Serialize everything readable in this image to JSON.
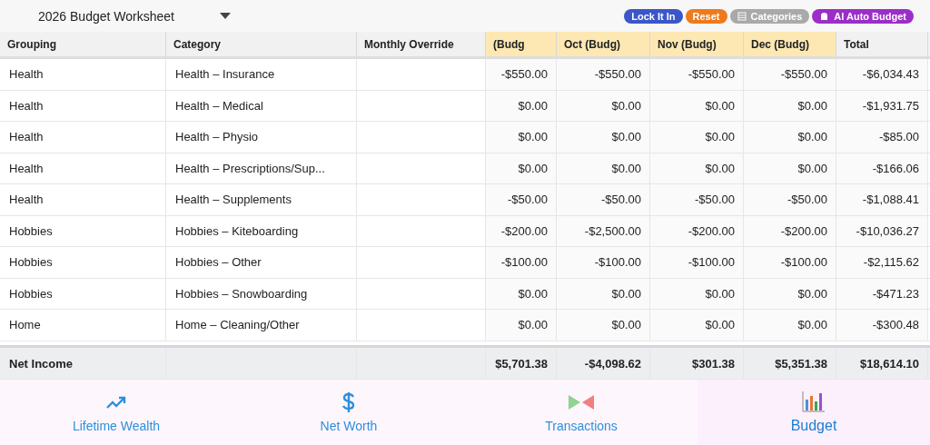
{
  "toolbar": {
    "title": "2026 Budget Worksheet",
    "buttons": [
      {
        "label": "Lock It In",
        "kind": "lock",
        "color": "#3a56c8"
      },
      {
        "label": "Reset",
        "kind": "reset",
        "color": "#ee7a1c"
      },
      {
        "label": "Categories",
        "kind": "categories",
        "color": "#a9a9a9"
      },
      {
        "label": "AI Auto Budget",
        "kind": "ai",
        "color": "#9b2ec8"
      }
    ]
  },
  "table": {
    "columns": [
      {
        "label": "Grouping",
        "kind": "frozen"
      },
      {
        "label": "Category",
        "kind": "frozen"
      },
      {
        "label": "Monthly Override",
        "kind": "frozen"
      },
      {
        "label": "(Budg",
        "kind": "month"
      },
      {
        "label": "Oct (Budg)",
        "kind": "month"
      },
      {
        "label": "Nov (Budg)",
        "kind": "month"
      },
      {
        "label": "Dec (Budg)",
        "kind": "month"
      },
      {
        "label": "Total",
        "kind": "total"
      }
    ],
    "rows": [
      {
        "grouping": "Health",
        "category": "Health – Insurance",
        "values": [
          "-$550.00",
          "-$550.00",
          "-$550.00",
          "-$550.00",
          "-$6,034.43"
        ]
      },
      {
        "grouping": "Health",
        "category": "Health – Medical",
        "values": [
          "$0.00",
          "$0.00",
          "$0.00",
          "$0.00",
          "-$1,931.75"
        ]
      },
      {
        "grouping": "Health",
        "category": "Health – Physio",
        "values": [
          "$0.00",
          "$0.00",
          "$0.00",
          "$0.00",
          "-$85.00"
        ]
      },
      {
        "grouping": "Health",
        "category": "Health – Prescriptions/Sup...",
        "values": [
          "$0.00",
          "$0.00",
          "$0.00",
          "$0.00",
          "-$166.06"
        ]
      },
      {
        "grouping": "Health",
        "category": "Health – Supplements",
        "values": [
          "-$50.00",
          "-$50.00",
          "-$50.00",
          "-$50.00",
          "-$1,088.41"
        ]
      },
      {
        "grouping": "Hobbies",
        "category": "Hobbies – Kiteboarding",
        "values": [
          "-$200.00",
          "-$2,500.00",
          "-$200.00",
          "-$200.00",
          "-$10,036.27"
        ]
      },
      {
        "grouping": "Hobbies",
        "category": "Hobbies – Other",
        "values": [
          "-$100.00",
          "-$100.00",
          "-$100.00",
          "-$100.00",
          "-$2,115.62"
        ]
      },
      {
        "grouping": "Hobbies",
        "category": "Hobbies – Snowboarding",
        "values": [
          "$0.00",
          "$0.00",
          "$0.00",
          "$0.00",
          "-$471.23"
        ]
      },
      {
        "grouping": "Home",
        "category": "Home – Cleaning/Other",
        "values": [
          "$0.00",
          "$0.00",
          "$0.00",
          "$0.00",
          "-$300.48"
        ]
      }
    ],
    "footer": {
      "label": "Net Income",
      "values": [
        "$5,701.38",
        "-$4,098.62",
        "$301.38",
        "$5,351.38",
        "$18,614.10"
      ]
    }
  },
  "tab_bar": [
    {
      "label": "Lifetime Wealth",
      "kind": "trend",
      "selected": false
    },
    {
      "label": "Net Worth",
      "kind": "dollar",
      "selected": false
    },
    {
      "label": "Transactions",
      "kind": "flow",
      "selected": false
    },
    {
      "label": "Budget",
      "kind": "bars",
      "selected": true
    }
  ]
}
